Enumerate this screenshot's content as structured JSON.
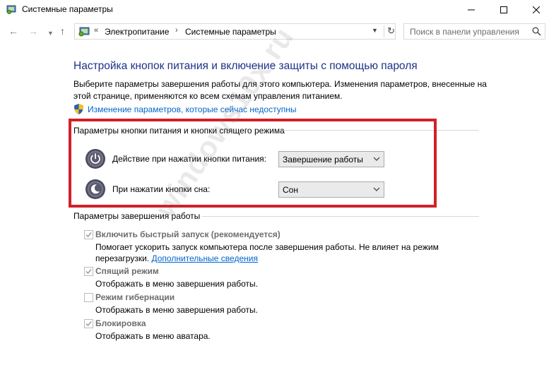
{
  "window": {
    "title": "Системные параметры"
  },
  "address": {
    "crumb_prefix": "«",
    "crumb1": "Электропитание",
    "separator": "›",
    "crumb2": "Системные параметры"
  },
  "search": {
    "placeholder": "Поиск в панели управления"
  },
  "main": {
    "title": "Настройка кнопок питания и включение защиты с помощью пароля",
    "description": "Выберите параметры завершения работы для этого компьютера. Изменения параметров, внесенные на этой странице, применяются ко всем схемам управления питанием.",
    "change_link": "Изменение параметров, которые сейчас недоступны"
  },
  "power_buttons": {
    "section_title": "Параметры кнопки питания и кнопки спящего режима",
    "rows": [
      {
        "label": "Действие при нажатии кнопки питания:",
        "value": "Завершение работы"
      },
      {
        "label": "При нажатии кнопки сна:",
        "value": "Сон"
      }
    ]
  },
  "shutdown": {
    "section_title": "Параметры завершения работы",
    "options": [
      {
        "label": "Включить быстрый запуск (рекомендуется)",
        "checked": true,
        "description": "Помогает ускорить запуск компьютера после завершения работы. Не влияет на режим",
        "description2": "перезагрузки.",
        "link": "Дополнительные сведения"
      },
      {
        "label": "Спящий режим",
        "checked": true,
        "description": "Отображать в меню завершения работы."
      },
      {
        "label": "Режим гибернации",
        "checked": false,
        "description": "Отображать в меню завершения работы."
      },
      {
        "label": "Блокировка",
        "checked": true,
        "description": "Отображать в меню аватара."
      }
    ]
  },
  "watermark": "windows10x.ru",
  "colors": {
    "title_blue": "#1e3287",
    "link_blue": "#0066cc",
    "highlight_red": "#d0202a"
  }
}
